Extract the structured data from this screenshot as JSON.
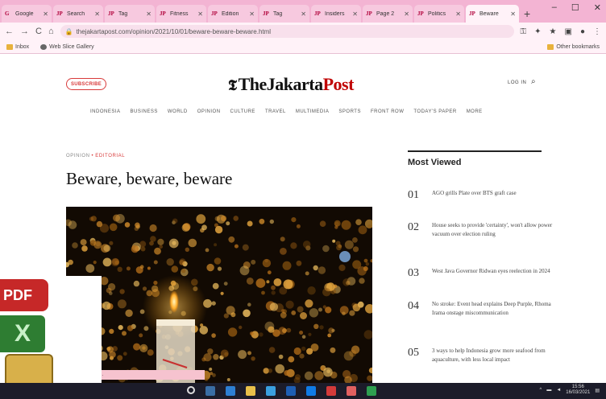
{
  "browser": {
    "tabs": [
      {
        "title": "Google"
      },
      {
        "title": "Search"
      },
      {
        "title": "Tag"
      },
      {
        "title": "Fitness"
      },
      {
        "title": "Edition"
      },
      {
        "title": "Tag"
      },
      {
        "title": "Insiders"
      },
      {
        "title": "Page 2"
      },
      {
        "title": "Politics"
      },
      {
        "title": "Beware",
        "active": true
      }
    ],
    "new_tab": "+",
    "url": "thejakartapost.com/opinion/2021/10/01/beware-beware-beware.html",
    "bookmarks": [
      {
        "label": "Inbox",
        "icon": "folder-icon"
      },
      {
        "label": "Web Slice Gallery",
        "icon": "globe-icon"
      }
    ],
    "other_bookmarks": "Other bookmarks"
  },
  "site": {
    "subscribe": "SUBSCRIBE",
    "logo_mark": "𝕿",
    "logo_prefix": "TheJakarta",
    "logo_accent": "Post",
    "login": "LOG IN",
    "nav": [
      "INDONESIA",
      "BUSINESS",
      "WORLD",
      "OPINION",
      "CULTURE",
      "TRAVEL",
      "MULTIMEDIA",
      "SPORTS",
      "FRONT ROW",
      "TODAY'S PAPER",
      "MORE"
    ]
  },
  "article": {
    "section": "OPINION",
    "separator": "•",
    "subsection": "EDITORIAL",
    "headline": "Beware, beware, beware",
    "caption": "..."
  },
  "most_viewed": {
    "title": "Most Viewed",
    "items": [
      {
        "num": "01",
        "text": "AGO grills Plate over BTS graft case"
      },
      {
        "num": "02",
        "text": "House seeks to provide 'certainty', won't allow power vacuum over election ruling"
      },
      {
        "num": "03",
        "text": "West Java Governor Ridwan eyes reelection in 2024"
      },
      {
        "num": "04",
        "text": "No stroke: Event head explains Deep Purple, Rhoma Irama onstage miscommunication"
      },
      {
        "num": "05",
        "text": "3 ways to help Indonesia grow more seafood from aquaculture, with less local impact"
      }
    ]
  },
  "desktop": {
    "pdf_label": "PDF",
    "xls_label": "X"
  },
  "taskbar": {
    "time": "15:56",
    "date": "16/03/2021"
  }
}
